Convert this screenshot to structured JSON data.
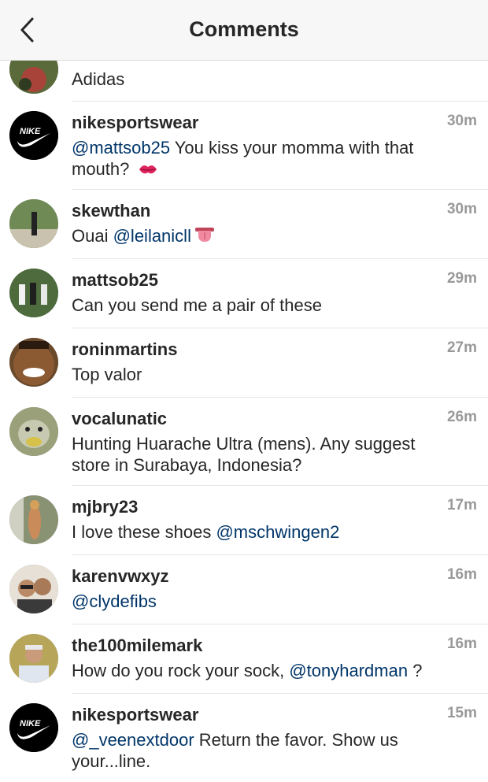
{
  "header": {
    "title": "Comments",
    "back_icon": "chevron-left-icon"
  },
  "first": {
    "text": "Adidas"
  },
  "comments": [
    {
      "user": "nikesportswear",
      "time": "30m",
      "mention": "@mattsob25",
      "text": " You kiss your momma with that mouth? ",
      "emoji": "kiss-mark-icon"
    },
    {
      "user": "skewthan",
      "time": "30m",
      "pre": "Ouai ",
      "mention": "@leilanicll",
      "emoji": "tongue-icon"
    },
    {
      "user": "mattsob25",
      "time": "29m",
      "text": "Can you send me a pair of these"
    },
    {
      "user": "roninmartins",
      "time": "27m",
      "text": "Top valor"
    },
    {
      "user": "vocalunatic",
      "time": "26m",
      "text": "Hunting Huarache Ultra (mens). Any suggest store in Surabaya, Indonesia?"
    },
    {
      "user": "mjbry23",
      "time": "17m",
      "pre": "I love these shoes ",
      "mention": "@mschwingen2"
    },
    {
      "user": "karenvwxyz",
      "time": "16m",
      "mention": "@clydefibs"
    },
    {
      "user": "the100milemark",
      "time": "16m",
      "pre": "How do you rock your sock, ",
      "mention": "@tonyhardman",
      "post": " ?"
    },
    {
      "user": "nikesportswear",
      "time": "15m",
      "mention": "@_veenextdoor",
      "text": " Return the favor. Show us your...line."
    }
  ]
}
